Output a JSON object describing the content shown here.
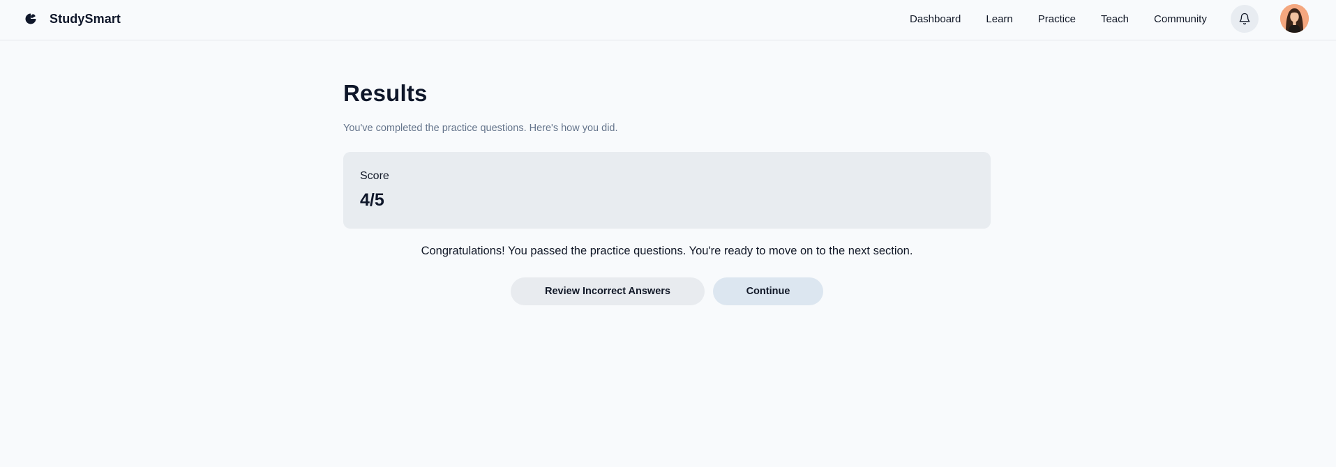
{
  "header": {
    "brand_name": "StudySmart",
    "logo_icon": "half-circle-logo-icon",
    "nav": [
      {
        "label": "Dashboard"
      },
      {
        "label": "Learn"
      },
      {
        "label": "Practice"
      },
      {
        "label": "Teach"
      },
      {
        "label": "Community"
      }
    ],
    "notification_icon": "bell-icon",
    "avatar_alt": "user-avatar"
  },
  "main": {
    "title": "Results",
    "subtitle": "You've completed the practice questions. Here's how you did.",
    "score": {
      "label": "Score",
      "value": "4/5"
    },
    "message": "Congratulations! You passed the practice questions. You're ready to move on to the next section.",
    "buttons": {
      "review_label": "Review Incorrect Answers",
      "continue_label": "Continue"
    }
  },
  "colors": {
    "background": "#f8fafc",
    "card": "#e8ecf0",
    "primary_button": "#dce6f0",
    "secondary_button": "#e8ebef",
    "muted_text": "#64748b"
  }
}
